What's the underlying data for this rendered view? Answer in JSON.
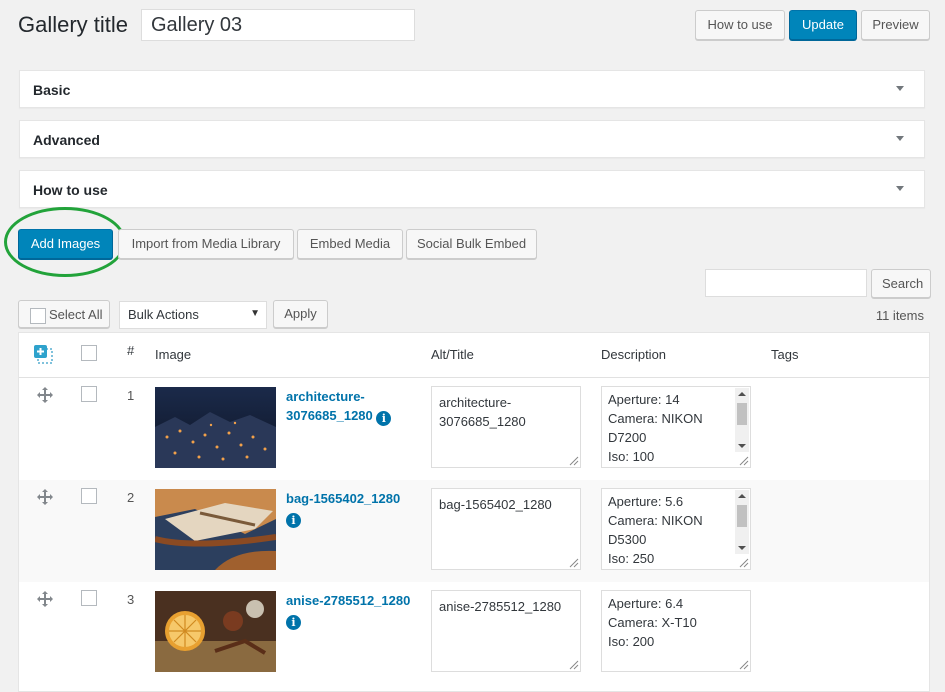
{
  "header": {
    "title_label": "Gallery title",
    "title_value": "Gallery 03",
    "how_to_use_button": "How to use",
    "update_button": "Update",
    "preview_button": "Preview"
  },
  "panels": [
    {
      "label": "Basic"
    },
    {
      "label": "Advanced"
    },
    {
      "label": "How to use"
    }
  ],
  "actions": {
    "add_images": "Add Images",
    "import_media": "Import from Media Library",
    "embed_media": "Embed Media",
    "social_bulk_embed": "Social Bulk Embed"
  },
  "search": {
    "button": "Search",
    "value": ""
  },
  "toolbar": {
    "select_all": "Select All",
    "bulk_actions": "Bulk Actions",
    "apply": "Apply",
    "items_count": "11 items"
  },
  "table": {
    "headers": {
      "num": "#",
      "image": "Image",
      "alt": "Alt/Title",
      "description": "Description",
      "tags": "Tags"
    },
    "rows": [
      {
        "num": "1",
        "title_a": "architecture-",
        "title_b": "3076685_1280",
        "alt_a": "architecture-",
        "alt_b": "3076685_1280",
        "desc": [
          "Aperture: 14",
          "Camera: NIKON",
          "D7200",
          "Iso: 100"
        ]
      },
      {
        "num": "2",
        "title_a": "bag-1565402_1280",
        "title_b": "",
        "alt_a": "bag-1565402_1280",
        "alt_b": "",
        "desc": [
          "Aperture: 5.6",
          "Camera: NIKON",
          "D5300",
          "Iso: 250"
        ]
      },
      {
        "num": "3",
        "title_a": "anise-2785512_1280",
        "title_b": "",
        "alt_a": "anise-2785512_1280",
        "alt_b": "",
        "desc": [
          "Aperture: 6.4",
          "Camera: X-T10",
          "Iso: 200",
          ""
        ]
      }
    ]
  },
  "colors": {
    "primary": "#0085ba",
    "link": "#0073aa",
    "highlight_ring": "#22a33a"
  }
}
